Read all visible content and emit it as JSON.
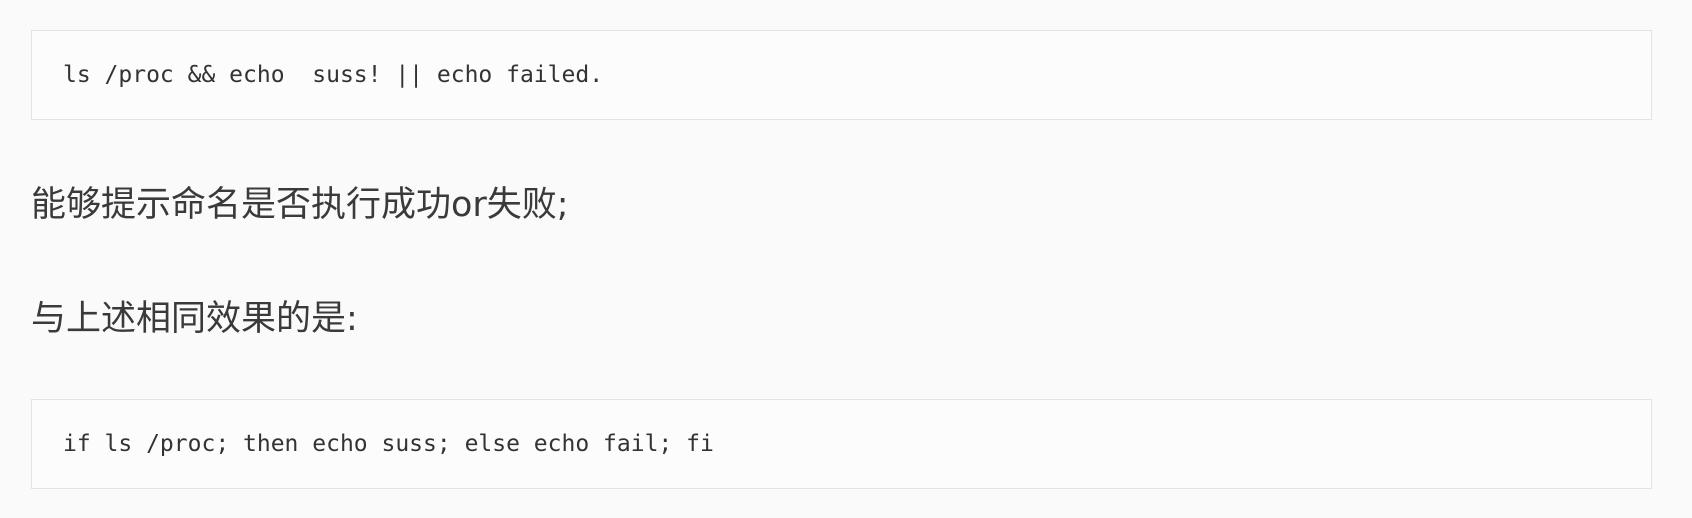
{
  "code_blocks": [
    {
      "text": "ls /proc && echo  suss! || echo failed."
    },
    {
      "text": "if ls /proc; then echo suss; else echo fail; fi"
    }
  ],
  "paragraphs": [
    {
      "text": "能够提示命名是否执行成功or失败;"
    },
    {
      "text": "与上述相同效果的是:"
    }
  ]
}
